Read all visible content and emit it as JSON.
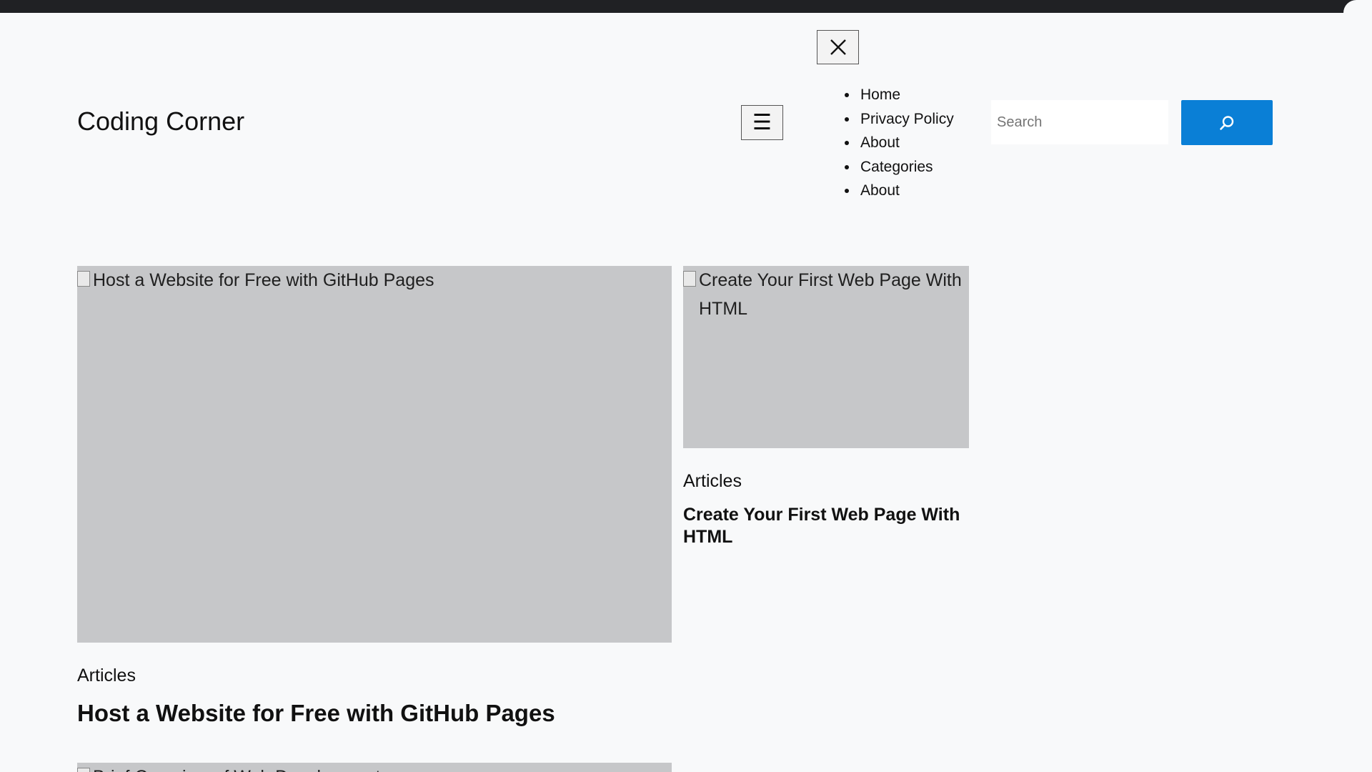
{
  "site": {
    "title": "Coding Corner"
  },
  "header": {
    "close_icon": "close-icon",
    "menu_icon": "hamburger-icon",
    "menu_glyph": "☰",
    "nav": [
      {
        "label": "Home"
      },
      {
        "label": "Privacy Policy"
      },
      {
        "label": "About"
      },
      {
        "label": "Categories"
      },
      {
        "label": "About"
      }
    ],
    "search": {
      "placeholder": "Search",
      "value": "",
      "button_icon": "search-icon",
      "button_color": "#0a7fd6"
    }
  },
  "posts": [
    {
      "image_alt": "Host a Website for Free with GitHub Pages",
      "category": "Articles",
      "title": "Host a Website for Free with GitHub Pages"
    },
    {
      "image_alt": "Create Your First Web Page With HTML",
      "category": "Articles",
      "title": "Create Your First Web Page With HTML"
    },
    {
      "image_alt": "Brief Overview of Web Development"
    }
  ],
  "colors": {
    "background": "#f8f9fa",
    "image_placeholder": "#c6c7c9",
    "accent": "#0a7fd6"
  }
}
